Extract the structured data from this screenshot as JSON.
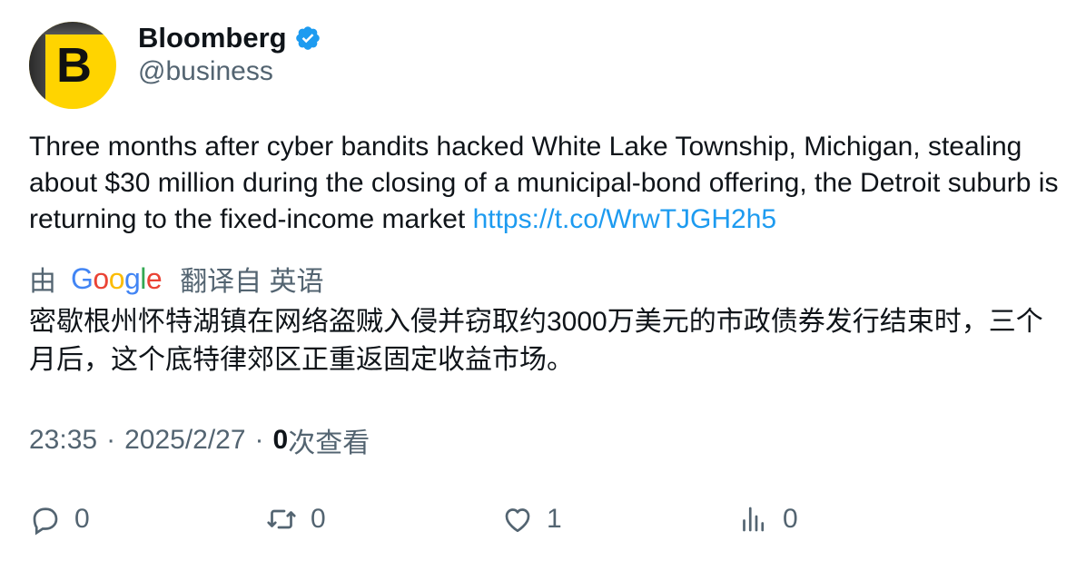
{
  "author": {
    "display_name": "Bloomberg",
    "handle": "@business",
    "avatar_letter": "B",
    "verified": true,
    "avatar_color": "#ffd400"
  },
  "tweet": {
    "text": "Three months after cyber bandits hacked White Lake Township, Michigan, stealing about $30 million during the closing of a municipal-bond offering, the Detroit suburb is returning to the fixed-income market ",
    "link": "https://t.co/WrwTJGH2h5"
  },
  "translation": {
    "prefix": "由",
    "provider": "Google",
    "suffix": "翻译自 英语",
    "text": "密歇根州怀特湖镇在网络盗贼入侵并窃取约3000万美元的市政债券发行结束时，三个月后，这个底特律郊区正重返固定收益市场。"
  },
  "meta": {
    "time": "23:35",
    "date": "2025/2/27",
    "views_count": "0",
    "views_label": "次查看"
  },
  "actions": {
    "reply_count": "0",
    "retweet_count": "0",
    "like_count": "1",
    "analytics_count": "0"
  },
  "colors": {
    "link": "#1d9bf0",
    "secondary_text": "#536471",
    "primary_text": "#0f1419",
    "verified_badge": "#1d9bf0"
  }
}
